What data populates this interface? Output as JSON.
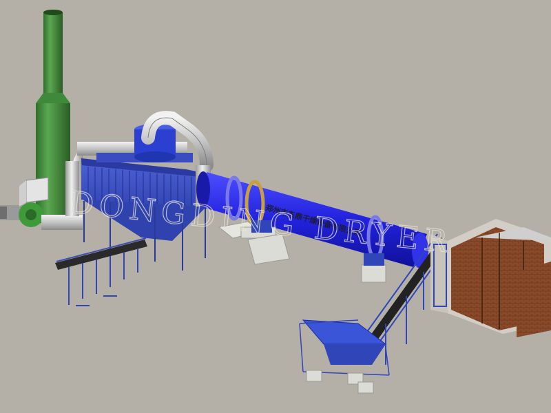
{
  "drum_inscription": "郑州市东鼎干燥设备有限公司",
  "watermark": "DONGDING DRYER",
  "colors": {
    "background": "#b4b0a8",
    "chimney": "#3f8a3a",
    "drum": "#2424e0",
    "pipe": "#c8c8c8",
    "frame": "#2f45b8",
    "furnace": "#8a4a2a",
    "conveyor": "#2a2a2a",
    "concrete": "#dcdcd6"
  }
}
